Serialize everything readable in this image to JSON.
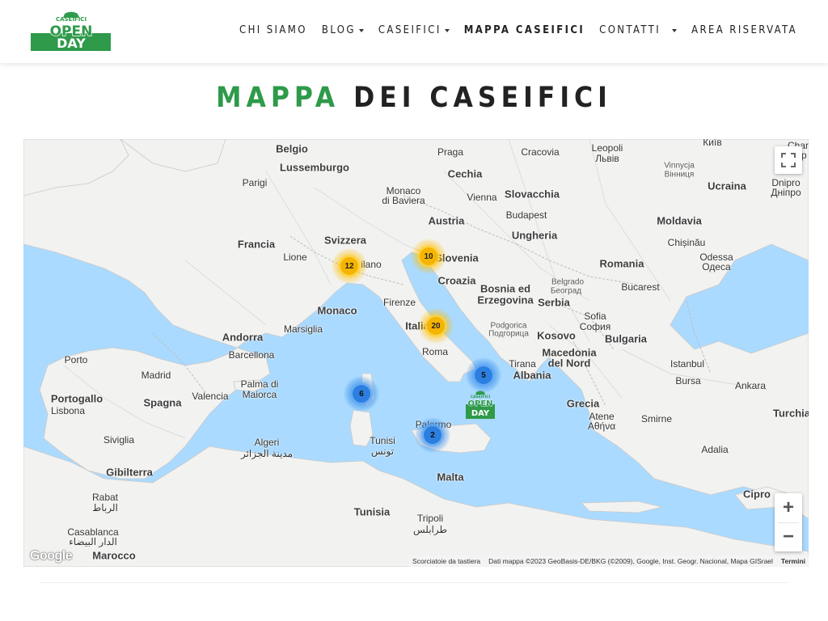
{
  "logo": {
    "top_text": "CASEIFICI",
    "line1": "OPEN",
    "line2": "DAY",
    "brand_green": "#2e9a4a"
  },
  "nav": {
    "items": [
      {
        "label": "CHI SIAMO",
        "caret": false,
        "active": false
      },
      {
        "label": "BLOG",
        "caret": true,
        "active": false
      },
      {
        "label": "CASEIFICI",
        "caret": true,
        "active": false
      },
      {
        "label": "MAPPA CASEIFICI",
        "caret": false,
        "active": true
      },
      {
        "label": "CONTATTI",
        "caret": true,
        "active": false
      },
      {
        "label": "AREA RISERVATA",
        "caret": false,
        "active": false
      }
    ]
  },
  "page_title": {
    "accent": "MAPPA",
    "rest": "DEI CASEIFICI"
  },
  "map": {
    "colors": {
      "sea": "#aadaff",
      "land": "#f2f2f0",
      "border": "#c9c9c9"
    },
    "clusters": [
      {
        "count": "12",
        "color": "yellow"
      },
      {
        "count": "10",
        "color": "yellow"
      },
      {
        "count": "20",
        "color": "yellow"
      },
      {
        "count": "5",
        "color": "blue"
      },
      {
        "count": "6",
        "color": "blue"
      },
      {
        "count": "2",
        "color": "blue"
      }
    ],
    "labels": {
      "belgio": "Belgio",
      "lussemburgo": "Lussemburgo",
      "parigi": "Parigi",
      "francia": "Francia",
      "lione": "Lione",
      "svizzera": "Svizzera",
      "milano": "ilano",
      "monaco": "Monaco",
      "marsiglia": "Marsiglia",
      "andorra": "Andorra",
      "barcellona": "Barcellona",
      "porto": "Porto",
      "madrid": "Madrid",
      "portogallo": "Portogallo",
      "lisbona": "Lisbona",
      "spagna": "Spagna",
      "valencia": "Valencia",
      "palma": "Palma di",
      "maiorca": "Maiorca",
      "siviglia": "Siviglia",
      "gibilterra": "Gibilterra",
      "algeri": "Algeri",
      "algeri_ar": "مدينة الجزائر",
      "rabat": "Rabat",
      "rabat_ar": "الرباط",
      "casablanca": "Casablanca",
      "casablanca_ar": "الدار البيضاء",
      "marocco": "Marocco",
      "tunisi": "Tunisi",
      "tunisi_ar": "تونس",
      "tunisia": "Tunisia",
      "palermo": "Palermo",
      "malta": "Malta",
      "tripoli": "Tripoli",
      "tripoli_ar": "طرابلس",
      "praga": "Praga",
      "cechia": "Cechia",
      "monaco_baviera": "Monaco",
      "di_baviera": "di Baviera",
      "vienna": "Vienna",
      "slovacchia": "Slovacchia",
      "austria": "Austria",
      "budapest": "Budapest",
      "ungheria": "Ungheria",
      "slovenia": "Slovenia",
      "croazia": "Croazia",
      "bosnia": "Bosnia ed",
      "erzegovina": "Erzegovina",
      "serbia": "Serbia",
      "belgrado": "Belgrado",
      "beograd": "Београд",
      "firenze": "Firenze",
      "italia": "Italia",
      "roma": "Roma",
      "podgorica": "Podgorica",
      "podgorica_cy": "Подгорица",
      "kosovo": "Kosovo",
      "tirana": "Tirana",
      "albania": "Albania",
      "macedonia": "Macedonia",
      "del_nord": "del Nord",
      "sofia": "Sofia",
      "sofia_cy": "София",
      "bulgaria": "Bulgaria",
      "grecia": "Grecia",
      "atene": "Atene",
      "atene_gr": "Αθήνα",
      "istanbul": "Istanbul",
      "bursa": "Bursa",
      "ankara": "Ankara",
      "smirne": "Smirne",
      "turchia": "Turchia",
      "adalia": "Adalia",
      "cipro": "Cipro",
      "romania": "Romania",
      "bucarest": "Bucarest",
      "moldavia": "Moldavia",
      "chisinau": "Chișinău",
      "odessa": "Odessa",
      "odessa_cy": "Одеса",
      "cracovia": "Cracovia",
      "leopoli": "Leopoli",
      "leopoli_cy": "Львів",
      "vinnycja": "Vinnycja",
      "vinnycja_cy": "Вінниця",
      "kyiv": "Київ",
      "ucraina": "Ucraina",
      "dnipro": "Dnipro",
      "dnipro_cy": "Дніпро",
      "char": "Char",
      "char2": "Хар"
    },
    "google_logo": "Google",
    "attribution": {
      "shortcuts": "Scorciatoie da tastiera",
      "data": "Dati mappa ©2023 GeoBasis-DE/BKG (©2009), Google, Inst. Geogr. Nacional, Mapa GISrael",
      "terms": "Termini"
    },
    "controls": {
      "zoom_in": "+",
      "zoom_out": "−"
    }
  }
}
